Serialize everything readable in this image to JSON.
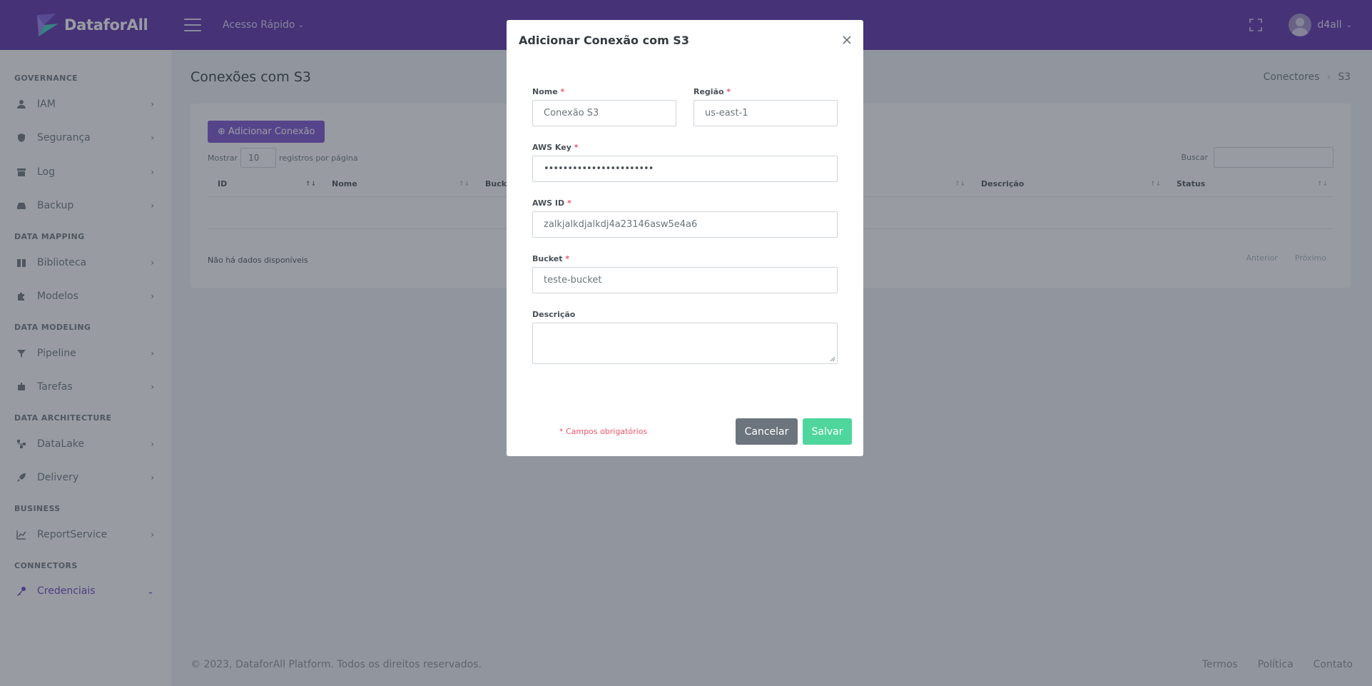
{
  "app": {
    "name": "DataforAll"
  },
  "topbar": {
    "quick_access": "Acesso Rápido",
    "username": "d4all"
  },
  "sidebar": {
    "sections": [
      {
        "title": "GOVERNANCE",
        "items": [
          {
            "label": "IAM",
            "icon": "user-icon"
          },
          {
            "label": "Segurança",
            "icon": "shield-icon"
          },
          {
            "label": "Log",
            "icon": "archive-icon"
          },
          {
            "label": "Backup",
            "icon": "hdd-icon"
          }
        ]
      },
      {
        "title": "DATA MAPPING",
        "items": [
          {
            "label": "Biblioteca",
            "icon": "book-icon"
          },
          {
            "label": "Modelos",
            "icon": "puzzle-icon"
          }
        ]
      },
      {
        "title": "DATA MODELING",
        "items": [
          {
            "label": "Pipeline",
            "icon": "filter-icon"
          },
          {
            "label": "Tarefas",
            "icon": "robot-icon"
          }
        ]
      },
      {
        "title": "DATA ARCHITECTURE",
        "items": [
          {
            "label": "DataLake",
            "icon": "sitemap-icon"
          },
          {
            "label": "Delivery",
            "icon": "rocket-icon"
          }
        ]
      },
      {
        "title": "BUSINESS",
        "items": [
          {
            "label": "ReportService",
            "icon": "chart-line-icon"
          }
        ]
      },
      {
        "title": "CONNECTORS",
        "items": [
          {
            "label": "Credenciais",
            "icon": "key-icon",
            "active": true
          }
        ]
      }
    ]
  },
  "page": {
    "title": "Conexões com S3",
    "breadcrumb": [
      "Conectores",
      "S3"
    ],
    "add_button": "Adicionar Conexão",
    "show_label": "Mostrar",
    "page_size": "10",
    "per_page_label": "registros por página",
    "search_label": "Buscar",
    "columns": [
      "ID",
      "Nome",
      "Bucket",
      "Descrição",
      "Status"
    ],
    "no_data": "Não há dados disponíveis",
    "prev": "Anterior",
    "next": "Próximo"
  },
  "footer": {
    "copyright": "© 2023, DataforAll Platform. Todos os direitos reservados.",
    "links": [
      "Termos",
      "Política",
      "Contato"
    ]
  },
  "modal": {
    "title": "Adicionar Conexão com S3",
    "fields": {
      "nome": {
        "label": "Nome",
        "value": "Conexão S3"
      },
      "regiao": {
        "label": "Região",
        "value": "us-east-1"
      },
      "aws_key": {
        "label": "AWS Key",
        "value": "•••••••••••••••••••••••"
      },
      "aws_id": {
        "label": "AWS ID",
        "value": "zalkjalkdjalkdj4a23146asw5e4a6"
      },
      "bucket": {
        "label": "Bucket",
        "value": "teste-bucket"
      },
      "descricao": {
        "label": "Descrição",
        "value": ""
      }
    },
    "required_asterisk": "*",
    "required_note": "* Campos obrigatórios",
    "cancel": "Cancelar",
    "save": "Salvar"
  },
  "colors": {
    "topbar": "#5b2ba8",
    "primary": "#7a4fd0",
    "active": "#6b3fc1",
    "save": "#4fd69c",
    "cancel": "#6c757d",
    "required": "#f1556c"
  }
}
